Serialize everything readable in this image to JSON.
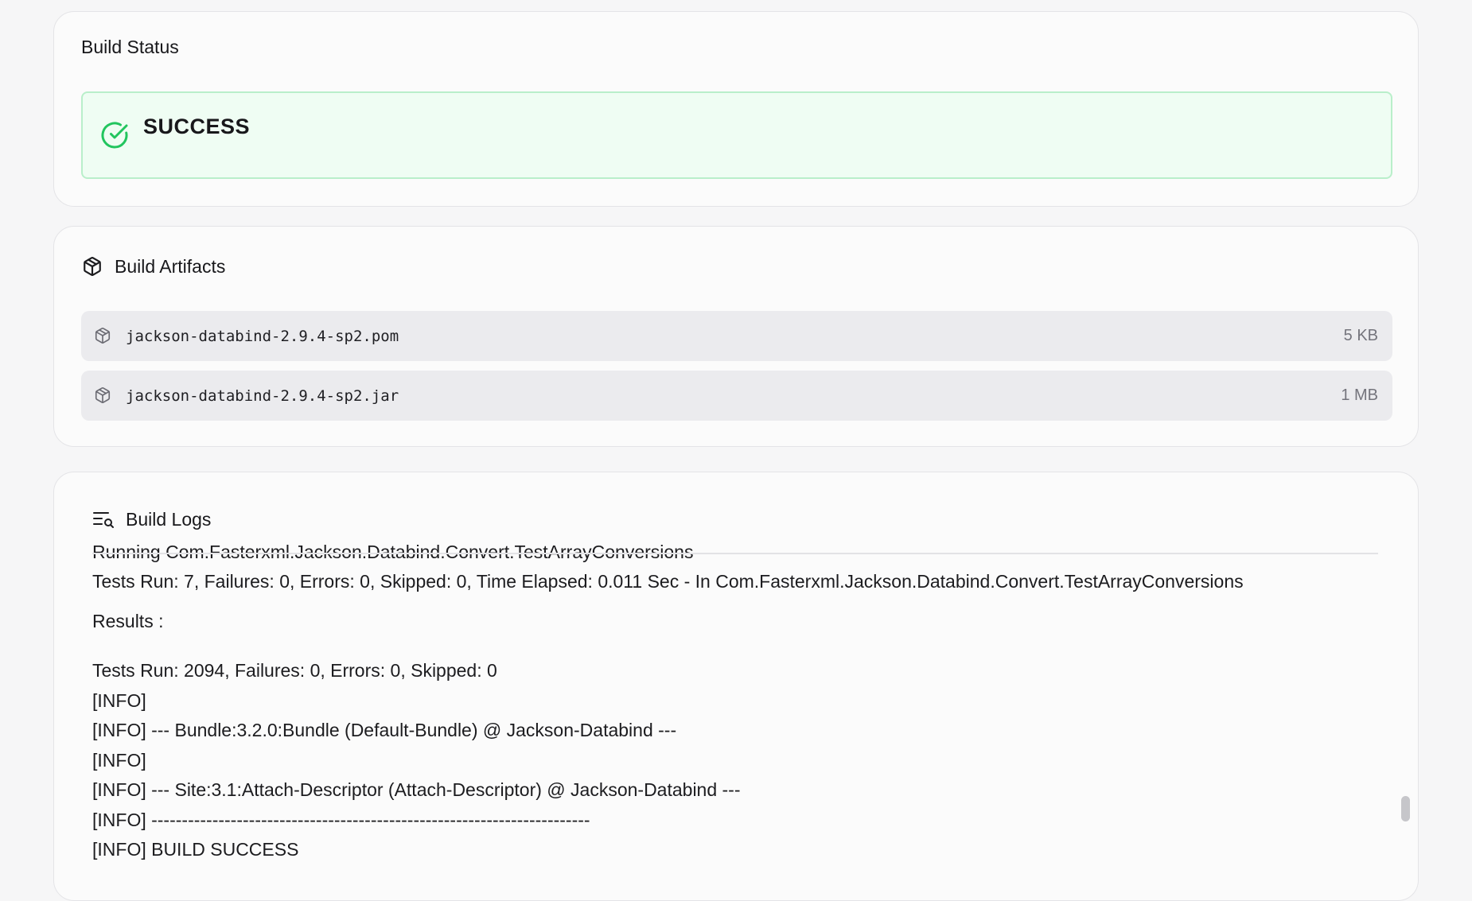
{
  "build_status": {
    "title": "Build Status",
    "status": "SUCCESS",
    "status_icon": "check-circle-icon",
    "status_color": "#22c55e"
  },
  "artifacts": {
    "title": "Build Artifacts",
    "icon": "package-icon",
    "items": [
      {
        "name": "jackson-databind-2.9.4-sp2.pom",
        "size": "5 KB"
      },
      {
        "name": "jackson-databind-2.9.4-sp2.jar",
        "size": "1 MB"
      }
    ]
  },
  "logs": {
    "title": "Build Logs",
    "icon": "log-search-icon",
    "lines": [
      "Running Com.Fasterxml.Jackson.Databind.Convert.TestArrayConversions",
      "Tests Run: 7, Failures: 0, Errors: 0, Skipped: 0, Time Elapsed: 0.011 Sec - In Com.Fasterxml.Jackson.Databind.Convert.TestArrayConversions",
      "Results :",
      "Tests Run: 2094, Failures: 0, Errors: 0, Skipped: 0",
      "[INFO]",
      "[INFO] --- Bundle:3.2.0:Bundle (Default-Bundle) @ Jackson-Databind ---",
      "[INFO]",
      "[INFO] --- Site:3.1:Attach-Descriptor (Attach-Descriptor) @ Jackson-Databind ---",
      "[INFO] ------------------------------------------------------------------------",
      "[INFO] BUILD SUCCESS"
    ]
  }
}
